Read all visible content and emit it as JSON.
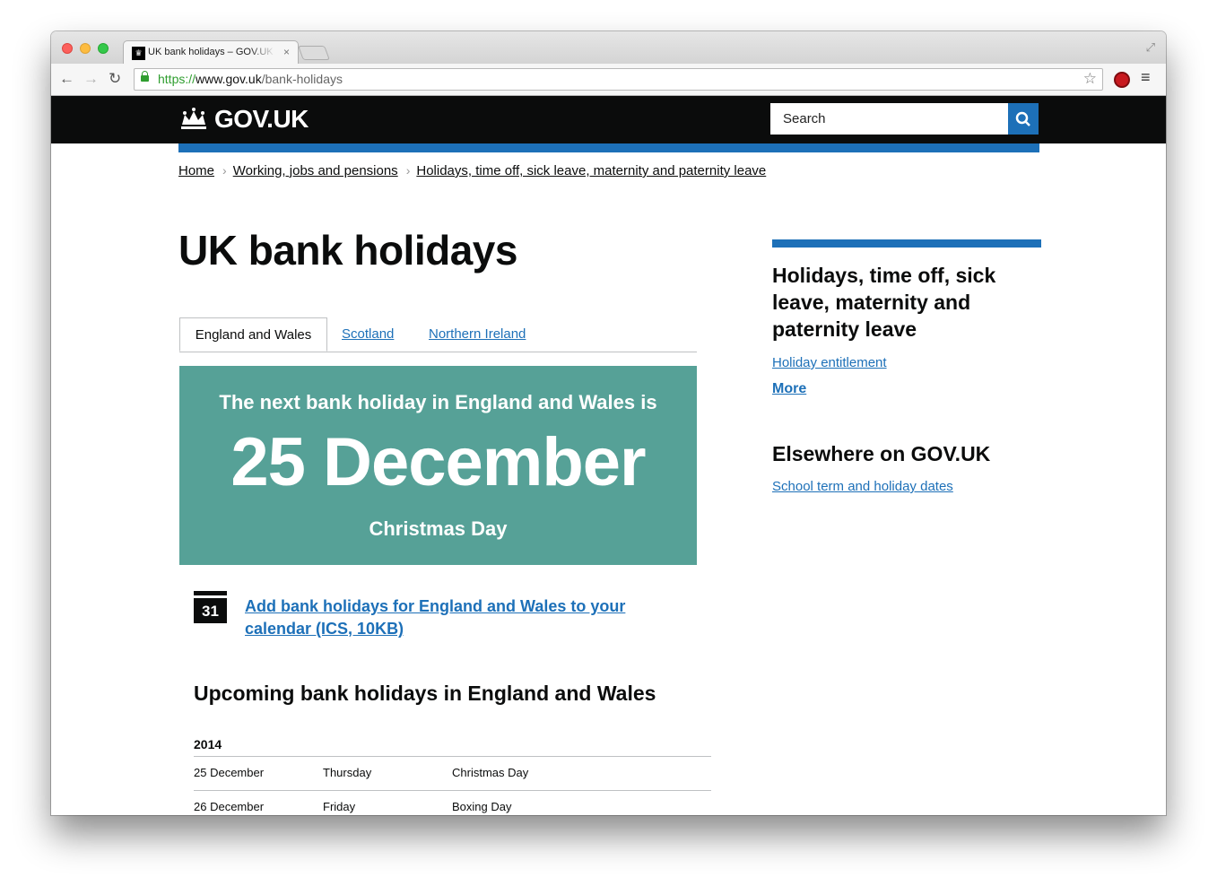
{
  "browser": {
    "tab_title": "UK bank holidays – GOV.UK",
    "tab_favicon": "crown-icon",
    "close_glyph": "×",
    "url_scheme": "https://",
    "url_host": "www.gov.uk",
    "url_path": "/bank-holidays"
  },
  "header": {
    "logo_text": "GOV.UK",
    "search_placeholder": "Search"
  },
  "breadcrumb": [
    "Home",
    "Working, jobs and pensions",
    "Holidays, time off, sick leave, maternity and paternity leave"
  ],
  "page_title": "UK bank holidays",
  "tabs": [
    "England and Wales",
    "Scotland",
    "Northern Ireland"
  ],
  "hero": {
    "intro": "The next bank holiday in England and Wales is",
    "date": "25 December",
    "name": "Christmas Day"
  },
  "calendar": {
    "icon_text": "31",
    "link_text": "Add bank holidays for England and Wales to your calendar (ICS, 10KB)"
  },
  "upcoming": {
    "heading": "Upcoming bank holidays in England and Wales",
    "year": "2014",
    "rows": [
      {
        "date": "25 December",
        "day": "Thursday",
        "name": "Christmas Day"
      },
      {
        "date": "26 December",
        "day": "Friday",
        "name": "Boxing Day"
      }
    ]
  },
  "sidebar": {
    "title": "Holidays, time off, sick leave, maternity and paternity leave",
    "link": "Holiday entitlement",
    "more": "More",
    "elsewhere_title": "Elsewhere on GOV.UK",
    "elsewhere_link": "School term and holiday dates"
  },
  "colors": {
    "header_bg": "#0b0c0c",
    "brand_blue": "#1d70b8",
    "hero_green": "#56a197"
  }
}
